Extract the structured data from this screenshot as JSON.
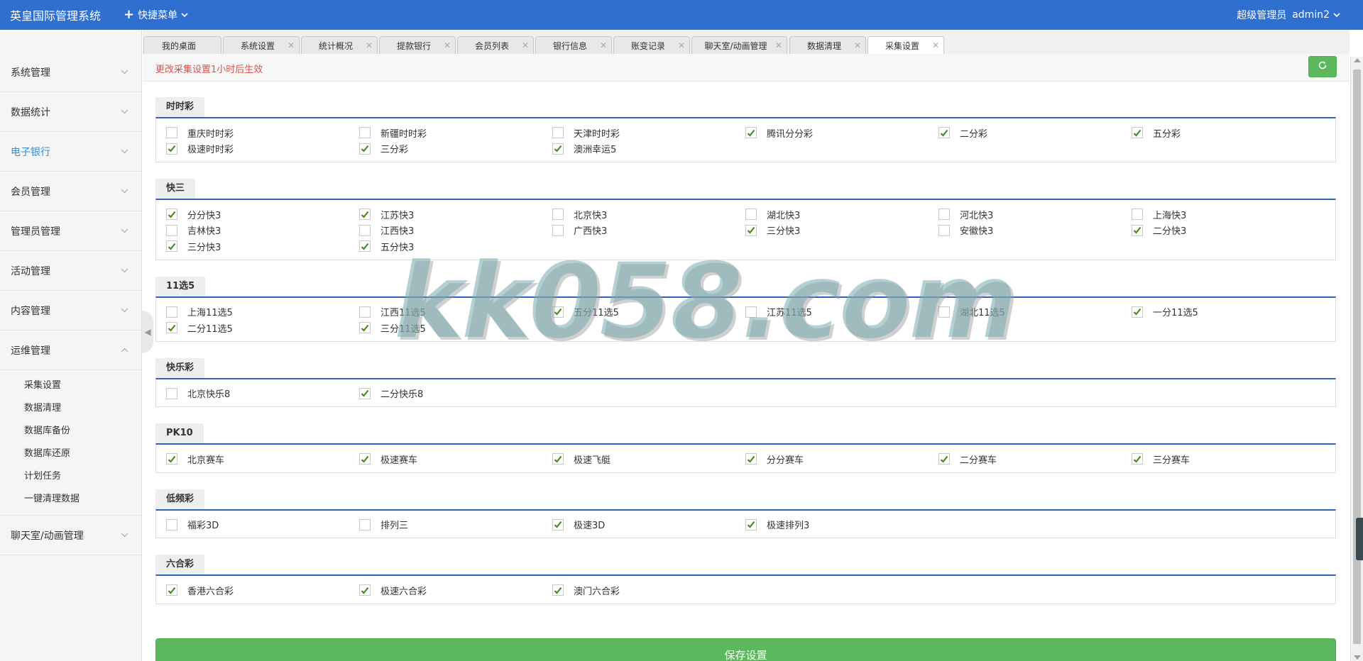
{
  "header": {
    "app_title": "英皇国际管理系统",
    "quick_menu": "快捷菜单",
    "role": "超级管理员",
    "username": "admin2"
  },
  "sidebar": {
    "items": [
      {
        "label": "系统管理"
      },
      {
        "label": "数据统计"
      },
      {
        "label": "电子银行"
      },
      {
        "label": "会员管理"
      },
      {
        "label": "管理员管理"
      },
      {
        "label": "活动管理"
      },
      {
        "label": "内容管理"
      },
      {
        "label": "运维管理"
      }
    ],
    "sub_items": [
      {
        "label": "采集设置"
      },
      {
        "label": "数据清理"
      },
      {
        "label": "数据库备份"
      },
      {
        "label": "数据库还原"
      },
      {
        "label": "计划任务"
      },
      {
        "label": "一键清理数据"
      }
    ],
    "last_item": {
      "label": "聊天室/动画管理"
    }
  },
  "tabs": [
    {
      "label": "我的桌面"
    },
    {
      "label": "系统设置"
    },
    {
      "label": "统计概况"
    },
    {
      "label": "提款银行"
    },
    {
      "label": "会员列表"
    },
    {
      "label": "银行信息"
    },
    {
      "label": "账变记录"
    },
    {
      "label": "聊天室/动画管理"
    },
    {
      "label": "数据清理"
    },
    {
      "label": "采集设置"
    }
  ],
  "notice": "更改采集设置1小时后生效",
  "groups": [
    {
      "title": "时时彩",
      "options": [
        {
          "label": "重庆时时彩",
          "checked": false
        },
        {
          "label": "新疆时时彩",
          "checked": false
        },
        {
          "label": "天津时时彩",
          "checked": false
        },
        {
          "label": "腾讯分分彩",
          "checked": true
        },
        {
          "label": "二分彩",
          "checked": true
        },
        {
          "label": "五分彩",
          "checked": true
        },
        {
          "label": "极速时时彩",
          "checked": true
        },
        {
          "label": "三分彩",
          "checked": true
        },
        {
          "label": "澳洲幸运5",
          "checked": true
        }
      ]
    },
    {
      "title": "快三",
      "options": [
        {
          "label": "分分快3",
          "checked": true
        },
        {
          "label": "江苏快3",
          "checked": true
        },
        {
          "label": "北京快3",
          "checked": false
        },
        {
          "label": "湖北快3",
          "checked": false
        },
        {
          "label": "河北快3",
          "checked": false
        },
        {
          "label": "上海快3",
          "checked": false
        },
        {
          "label": "吉林快3",
          "checked": false
        },
        {
          "label": "江西快3",
          "checked": false
        },
        {
          "label": "广西快3",
          "checked": false
        },
        {
          "label": "三分快3",
          "checked": true
        },
        {
          "label": "安徽快3",
          "checked": false
        },
        {
          "label": "二分快3",
          "checked": true
        },
        {
          "label": "三分快3",
          "checked": true
        },
        {
          "label": "五分快3",
          "checked": true
        }
      ]
    },
    {
      "title": "11选5",
      "options": [
        {
          "label": "上海11选5",
          "checked": false
        },
        {
          "label": "江西11选5",
          "checked": false
        },
        {
          "label": "五分11选5",
          "checked": true
        },
        {
          "label": "江苏11选5",
          "checked": false
        },
        {
          "label": "湖北11选5",
          "checked": false
        },
        {
          "label": "一分11选5",
          "checked": true
        },
        {
          "label": "二分11选5",
          "checked": true
        },
        {
          "label": "三分11选5",
          "checked": true
        }
      ]
    },
    {
      "title": "快乐彩",
      "options": [
        {
          "label": "北京快乐8",
          "checked": false
        },
        {
          "label": "二分快乐8",
          "checked": true
        }
      ]
    },
    {
      "title": "PK10",
      "options": [
        {
          "label": "北京赛车",
          "checked": true
        },
        {
          "label": "极速赛车",
          "checked": true
        },
        {
          "label": "极速飞艇",
          "checked": true
        },
        {
          "label": "分分赛车",
          "checked": true
        },
        {
          "label": "二分赛车",
          "checked": true
        },
        {
          "label": "三分赛车",
          "checked": true
        }
      ]
    },
    {
      "title": "低频彩",
      "options": [
        {
          "label": "福彩3D",
          "checked": false
        },
        {
          "label": "排列三",
          "checked": false
        },
        {
          "label": "极速3D",
          "checked": true
        },
        {
          "label": "极速排列3",
          "checked": true
        }
      ]
    },
    {
      "title": "六合彩",
      "options": [
        {
          "label": "香港六合彩",
          "checked": true
        },
        {
          "label": "极速六合彩",
          "checked": true
        },
        {
          "label": "澳门六合彩",
          "checked": true
        }
      ]
    }
  ],
  "save_button": "保存设置",
  "watermark": "kk058.com",
  "colors": {
    "header_bg": "#2e6fcf",
    "group_border": "#2e64b8",
    "save_bg": "#5cb85c",
    "check_color": "#4a8a1a",
    "notice_color": "#d9534f",
    "active_sidebar": "#2f8fdc"
  }
}
